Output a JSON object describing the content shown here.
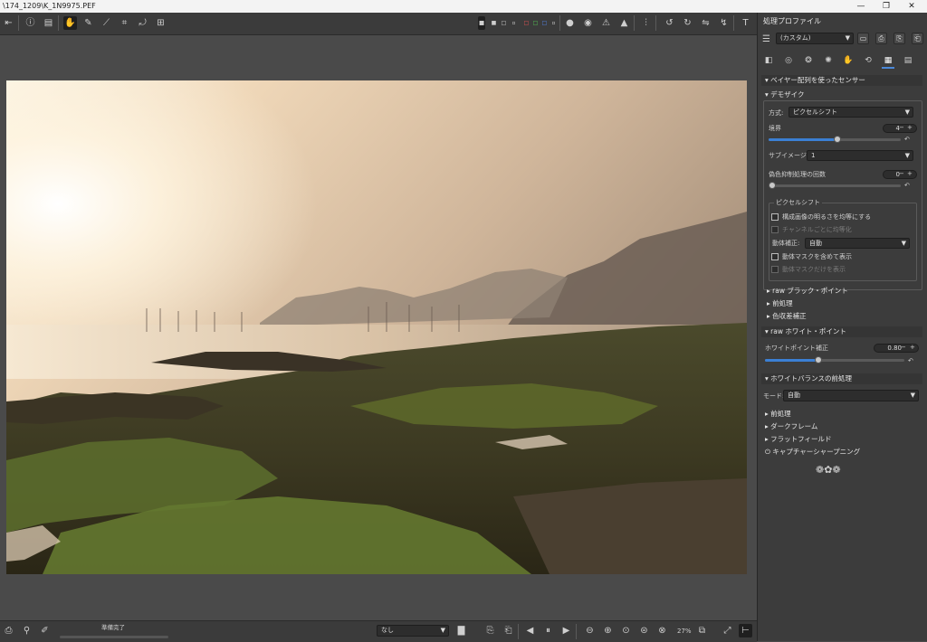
{
  "window": {
    "title": "\\174_1209\\K_1N9975.PEF",
    "minimize": "—",
    "restore": "❐",
    "close": "✕"
  },
  "toolbar": {
    "icons": [
      "panel-toggle-icon",
      "info-icon",
      "before-after-icon",
      "hand-icon",
      "color-picker-icon",
      "straighten-icon",
      "crop-icon",
      "rotate-icon",
      "perspective-icon"
    ],
    "right_icons": [
      "channel-select-icon",
      "clip-preview-icon",
      "focus-mask-icon",
      "shadow-warning-icon",
      "highlight-warning-icon",
      "histogram-icon",
      "rotate-left-icon",
      "rotate-right-icon",
      "flip-h-icon",
      "flip-v-icon",
      "text-icon"
    ]
  },
  "panel": {
    "title": "処理プロファイル",
    "profile": "(カスタム)",
    "tabs": [
      "exposure-tab",
      "detail-tab",
      "color-tab",
      "advanced-tab",
      "locallab-tab",
      "transform-tab",
      "raw-tab",
      "metadata-tab"
    ],
    "sections": {
      "bayer": "ベイヤー配列を使ったセンサー",
      "demosaic": "デモザイク",
      "method_label": "方式:",
      "method_value": "ピクセルシフト",
      "border_label": "境界",
      "border_value": "4",
      "subimage_label": "サブイメージ:",
      "subimage_value": "1",
      "falsecolor_label": "偽色抑制処理の回数",
      "falsecolor_value": "0",
      "pixelshift_title": "ピクセルシフト",
      "ps_equalize": "構成画像の明るさを均等にする",
      "ps_channel": "チャンネルごとに均等化",
      "ps_motion_label": "動体補正:",
      "ps_motion_value": "自動",
      "ps_showmask": "動体マスクを含めて表示",
      "ps_maskonly": "動体マスクだけを表示",
      "raw_black": "raw ブラック・ポイント",
      "preprocess": "前処理",
      "ca": "色収差補正",
      "raw_white": "raw ホワイト・ポイント",
      "wp_label": "ホワイトポイント補正",
      "wp_value": "0.80",
      "wb_pre": "ホワイトバランスの前処理",
      "mode_label": "モード:",
      "mode_value": "自動",
      "pre2": "前処理",
      "darkframe": "ダークフレーム",
      "flatfield": "フラットフィールド",
      "capture_sharp": "キャプチャーシャープニング",
      "ornament": "❁✿❁"
    }
  },
  "status": {
    "message": "準備完了",
    "filter": "なし",
    "zoom": "27%"
  },
  "sliders": {
    "border": 0.52,
    "falsecolor": 0.0,
    "whitepoint": 0.38
  }
}
